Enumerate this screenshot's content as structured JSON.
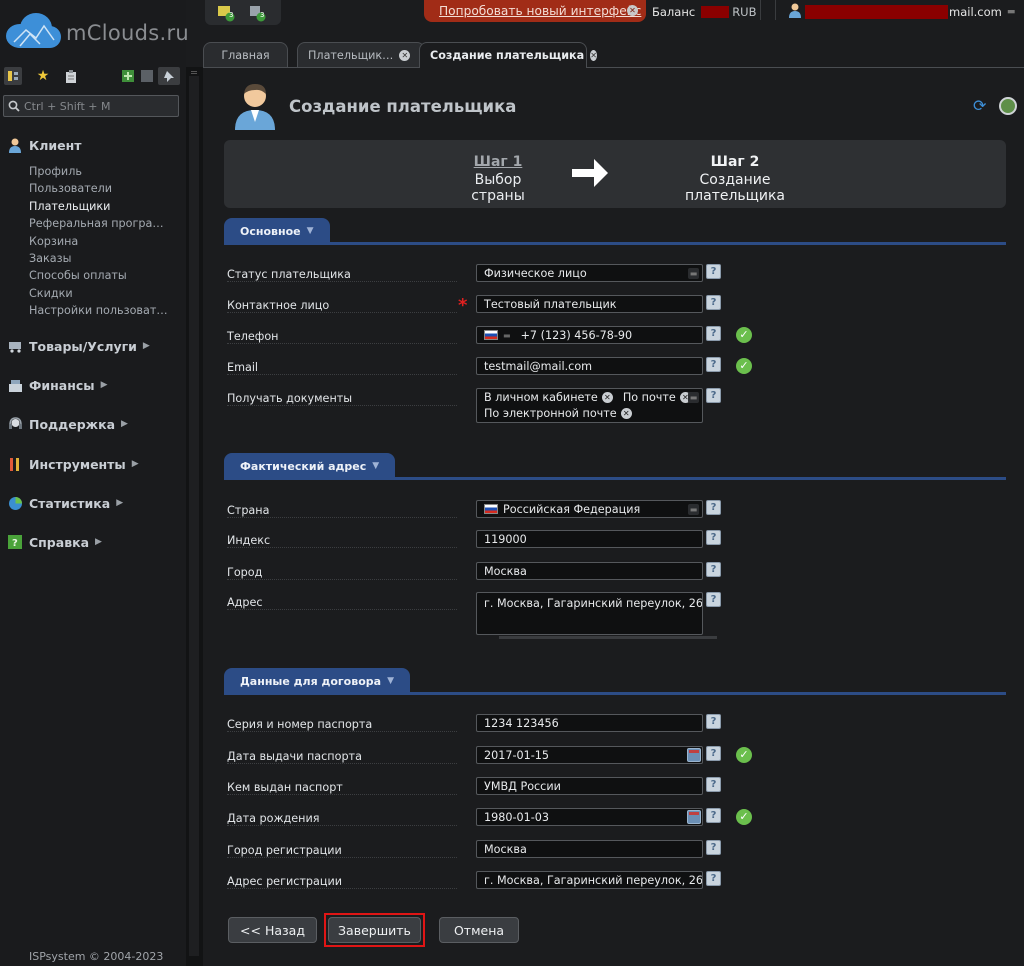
{
  "app": {
    "logo_text": "mClouds.ru",
    "search_placeholder": "Ctrl + Shift + M",
    "copyright": "ISPsystem © 2004-2023"
  },
  "topbar": {
    "try_new_label": "Попробовать новый интерфейс",
    "balance_label": "Баланс",
    "balance_currency": "RUB",
    "user_email_suffix": "mail.com",
    "ticket_counts": [
      "3",
      "3"
    ]
  },
  "sidebar": {
    "client_title": "Клиент",
    "client_items": [
      "Профиль",
      "Пользователи",
      "Плательщики",
      "Реферальная програ…",
      "Корзина",
      "Заказы",
      "Способы оплаты",
      "Скидки",
      "Настройки пользоват…"
    ],
    "active_item": "Плательщики",
    "sections": [
      "Товары/Услуги",
      "Финансы",
      "Поддержка",
      "Инструменты",
      "Статистика",
      "Справка"
    ]
  },
  "tabs": [
    {
      "label": "Главная",
      "closable": false
    },
    {
      "label": "Плательщик…",
      "closable": true
    },
    {
      "label": "Создание плательщика",
      "closable": true,
      "active": true
    }
  ],
  "page": {
    "title": "Создание плательщика",
    "step1_num": "Шаг 1",
    "step1_desc": "Выбор страны",
    "step2_num": "Шаг 2",
    "step2_desc": "Создание плательщика"
  },
  "sections": {
    "basic": "Основное",
    "address": "Фактический адрес",
    "contract": "Данные для договора"
  },
  "form": {
    "payer_status": {
      "label": "Статус плательщика",
      "value": "Физическое лицо"
    },
    "contact": {
      "label": "Контактное лицо",
      "value": "Тестовый плательщик",
      "required": true
    },
    "phone": {
      "label": "Телефон",
      "value": "+7 (123) 456-78-90"
    },
    "email": {
      "label": "Email",
      "value": "testmail@mail.com"
    },
    "docs": {
      "label": "Получать документы",
      "chips": [
        "В личном кабинете",
        "По почте",
        "По электронной почте"
      ]
    },
    "country": {
      "label": "Страна",
      "value": "Российская Федерация"
    },
    "index": {
      "label": "Индекс",
      "value": "119000"
    },
    "city": {
      "label": "Город",
      "value": "Москва"
    },
    "address": {
      "label": "Адрес",
      "value": "г. Москва, Гагаринский переулок, 26"
    },
    "passport": {
      "label": "Серия и номер паспорта",
      "value": "1234 123456"
    },
    "passport_date": {
      "label": "Дата выдачи паспорта",
      "value": "2017-01-15"
    },
    "passport_issuer": {
      "label": "Кем выдан паспорт",
      "value": "УМВД России"
    },
    "birth_date": {
      "label": "Дата рождения",
      "value": "1980-01-03"
    },
    "reg_city": {
      "label": "Город регистрации",
      "value": "Москва"
    },
    "reg_address": {
      "label": "Адрес регистрации",
      "value": "г. Москва, Гагаринский переулок, 26"
    }
  },
  "buttons": {
    "back": "<< Назад",
    "finish": "Завершить",
    "cancel": "Отмена"
  },
  "colors": {
    "accent": "#2c4c86",
    "try_new_bg": "#a12c17",
    "redaction": "#8a0000",
    "ok": "#6bbf4d"
  },
  "icons": {
    "help": "?",
    "ok": "✓",
    "close": "×"
  }
}
